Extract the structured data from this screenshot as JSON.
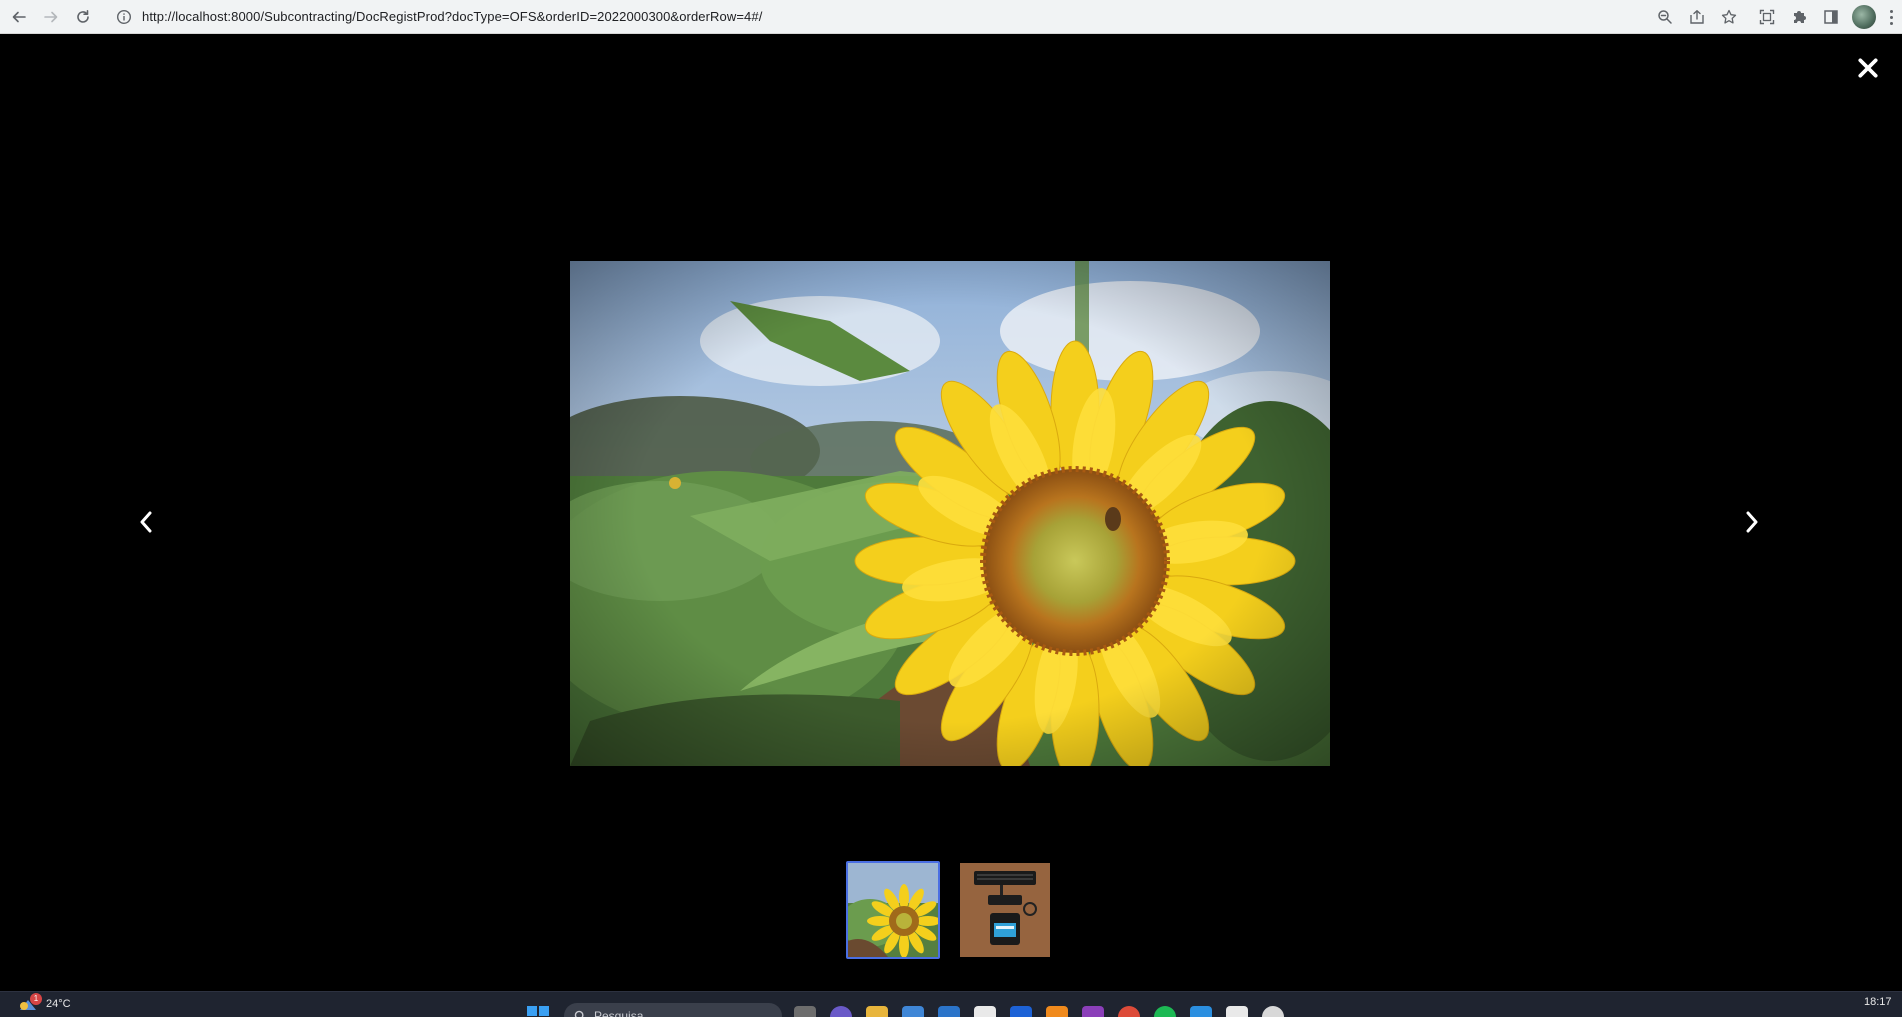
{
  "browser": {
    "url": "http://localhost:8000/Subcontracting/DocRegistProd?docType=OFS&orderID=2022000300&orderRow=4#/"
  },
  "lightbox": {
    "images": [
      {
        "name": "sunflower",
        "active": true
      },
      {
        "name": "device-on-desk",
        "active": false
      }
    ]
  },
  "taskbar": {
    "weather_temp": "24°C",
    "weather_badge": "1",
    "search_placeholder": "Pesquisa",
    "time": "18:17"
  },
  "colors": {
    "active_thumb_border": "#4a6fe3",
    "lightbox_bg": "#000000"
  }
}
